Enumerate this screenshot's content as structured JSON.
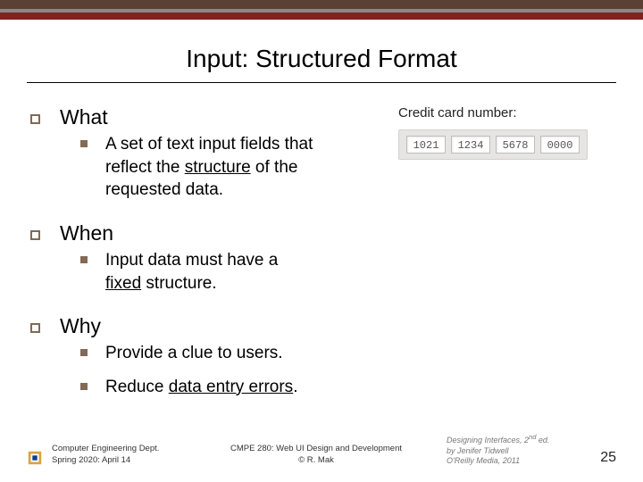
{
  "title": "Input: Structured Format",
  "credit": {
    "label": "Credit card number:",
    "segs": [
      "1021",
      "1234",
      "5678",
      "0000"
    ]
  },
  "sections": {
    "what": {
      "title": "What",
      "item1_pre": "A set of text input fields that reflect the ",
      "item1_ul": "structure",
      "item1_post": " of the requested data."
    },
    "when": {
      "title": "When",
      "item1_pre": "Input data must have a ",
      "item1_ul": "fixed",
      "item1_post": " structure."
    },
    "why": {
      "title": "Why",
      "item1": "Provide a clue to users.",
      "item2_pre": "Reduce ",
      "item2_ul": "data entry errors",
      "item2_post": "."
    }
  },
  "footer": {
    "dept1": "Computer Engineering Dept.",
    "dept2": "Spring 2020: April 14",
    "course1": "CMPE 280: Web UI Design and Development",
    "course2": "© R. Mak",
    "cite1": "Designing Interfaces, 2",
    "cite1_sup": "nd",
    "cite1_post": " ed.",
    "cite2": "by Jenifer Tidwell",
    "cite3": "O'Reilly Media, 2011",
    "page": "25"
  }
}
